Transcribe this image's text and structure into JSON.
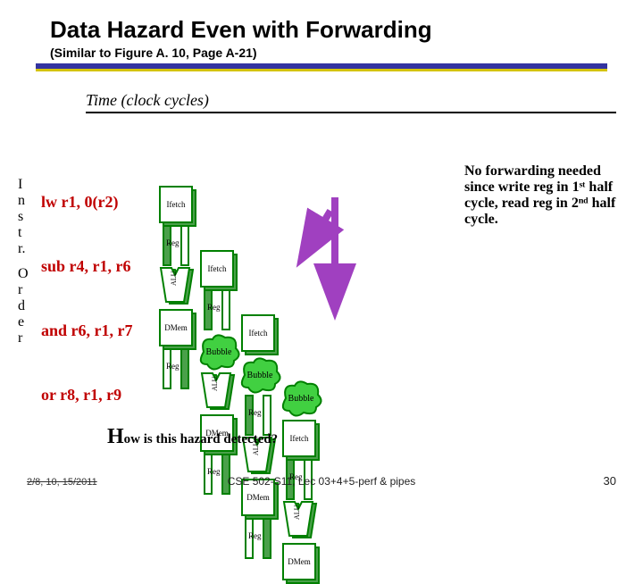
{
  "title": "Data Hazard Even with Forwarding",
  "subtitle": "(Similar to Figure A. 10, Page A-21)",
  "time_label": "Time (clock cycles)",
  "left_vertical": "Instr. Order",
  "instructions": {
    "i0": "lw r1, 0(r2)",
    "i1": "sub r4, r1, r6",
    "i2": "and r6, r1, r7",
    "i3": "or   r8, r1, r9"
  },
  "stage_labels": {
    "ifetch": "Ifetch",
    "reg": "Reg",
    "alu": "ALU",
    "dmem": "DMem",
    "bubble": "Bubble"
  },
  "note": "No forwarding needed since write reg in 1ˢᵗ half cycle, read reg in 2ⁿᵈ half cycle.",
  "how_question_big": "H",
  "how_question_rest": "ow is this hazard detected?",
  "strike_date": "2/8, 10, 15/2011",
  "footer_text": "CSE 502-S11, Lec 03+4+5-perf & pipes",
  "page_number": "30"
}
